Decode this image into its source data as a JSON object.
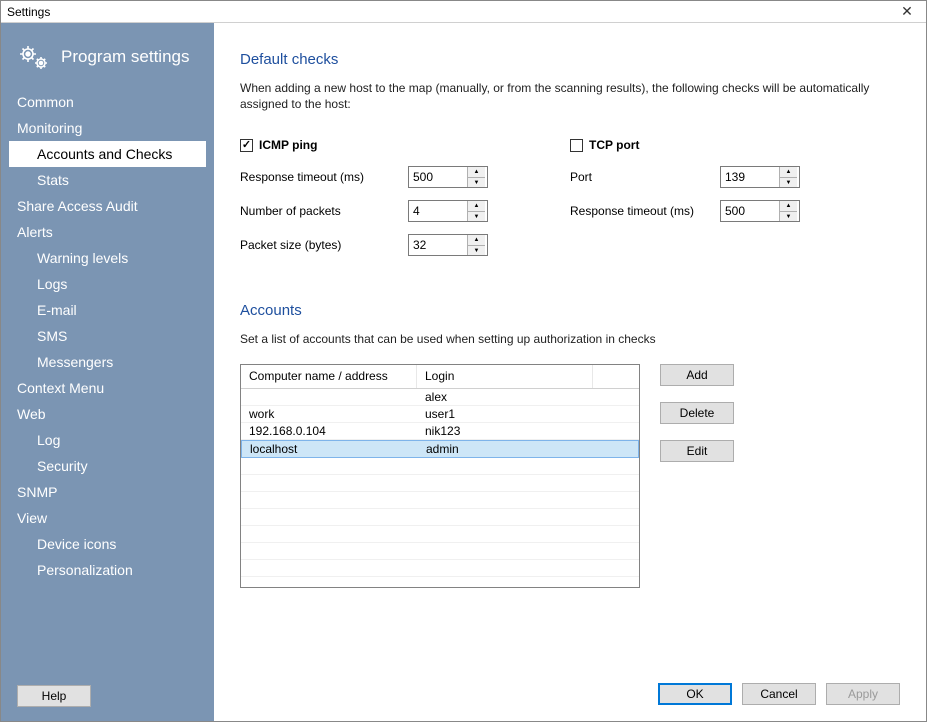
{
  "window": {
    "title": "Settings"
  },
  "sidebar": {
    "heading": "Program settings",
    "items": [
      {
        "label": "Common",
        "indent": false
      },
      {
        "label": "Monitoring",
        "indent": false
      },
      {
        "label": "Accounts and Checks",
        "indent": true,
        "selected": true
      },
      {
        "label": "Stats",
        "indent": true
      },
      {
        "label": "Share Access Audit",
        "indent": false
      },
      {
        "label": "Alerts",
        "indent": false
      },
      {
        "label": "Warning levels",
        "indent": true
      },
      {
        "label": "Logs",
        "indent": true
      },
      {
        "label": "E-mail",
        "indent": true
      },
      {
        "label": "SMS",
        "indent": true
      },
      {
        "label": "Messengers",
        "indent": true
      },
      {
        "label": "Context Menu",
        "indent": false
      },
      {
        "label": "Web",
        "indent": false
      },
      {
        "label": "Log",
        "indent": true
      },
      {
        "label": "Security",
        "indent": true
      },
      {
        "label": "SNMP",
        "indent": false
      },
      {
        "label": "View",
        "indent": false
      },
      {
        "label": "Device icons",
        "indent": true
      },
      {
        "label": "Personalization",
        "indent": true
      }
    ],
    "help_label": "Help"
  },
  "main": {
    "default_checks": {
      "title": "Default checks",
      "description": "When adding a new host to the map (manually, or from the scanning results), the following checks will be automatically assigned to the host:",
      "icmp": {
        "label": "ICMP ping",
        "checked": true,
        "response_timeout_label": "Response timeout (ms)",
        "response_timeout_value": "500",
        "packets_label": "Number of packets",
        "packets_value": "4",
        "packet_size_label": "Packet size (bytes)",
        "packet_size_value": "32"
      },
      "tcp": {
        "label": "TCP port",
        "checked": false,
        "port_label": "Port",
        "port_value": "139",
        "response_timeout_label": "Response timeout (ms)",
        "response_timeout_value": "500"
      }
    },
    "accounts": {
      "title": "Accounts",
      "description": "Set a list of accounts that can be used when setting up authorization in checks",
      "columns": {
        "computer": "Computer name / address",
        "login": "Login"
      },
      "rows": [
        {
          "computer": "",
          "login": "alex",
          "selected": false
        },
        {
          "computer": "work",
          "login": "user1",
          "selected": false
        },
        {
          "computer": "192.168.0.104",
          "login": "nik123",
          "selected": false
        },
        {
          "computer": "localhost",
          "login": "admin",
          "selected": true
        }
      ],
      "buttons": {
        "add": "Add",
        "delete": "Delete",
        "edit": "Edit"
      }
    }
  },
  "footer": {
    "ok": "OK",
    "cancel": "Cancel",
    "apply": "Apply"
  }
}
